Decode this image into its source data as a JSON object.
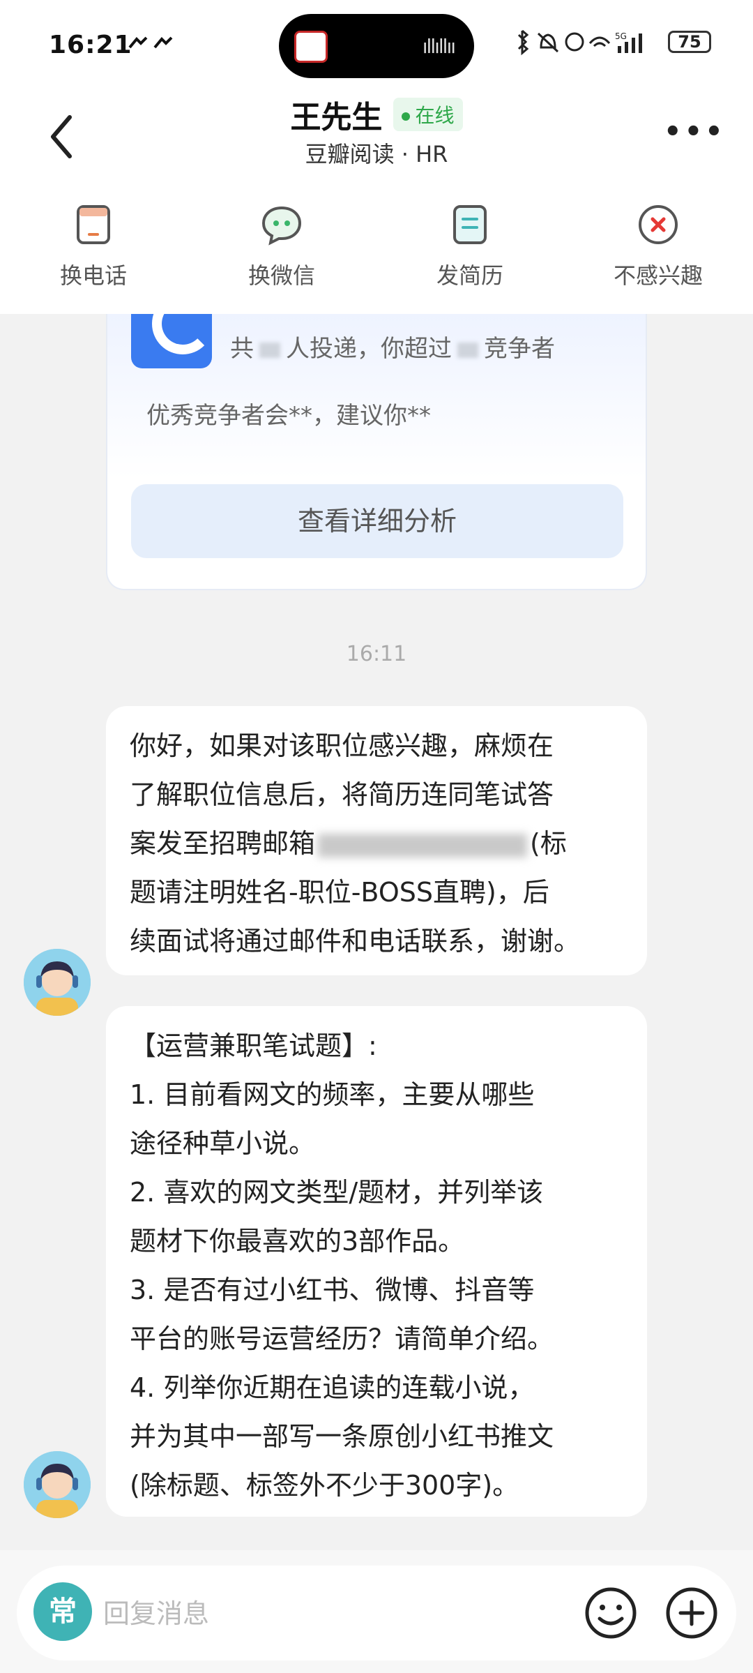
{
  "status_bar": {
    "time": "16:21",
    "battery": "75",
    "network": "5G"
  },
  "header": {
    "title": "王先生",
    "online_label": "在线",
    "subtitle": "豆瓣阅读 · HR"
  },
  "actions": [
    {
      "label": "换电话",
      "icon": "phone-icon"
    },
    {
      "label": "换微信",
      "icon": "wechat-icon"
    },
    {
      "label": "发简历",
      "icon": "resume-icon"
    },
    {
      "label": "不感兴趣",
      "icon": "not-interested-icon"
    }
  ],
  "card": {
    "stat_prefix": "共",
    "stat_mid": "人投递，你超过",
    "stat_suffix": "竞争者",
    "tip": "优秀竞争者会**，建议你**",
    "button": "查看详细分析"
  },
  "chat": {
    "timestamp": "16:11",
    "message1": {
      "lines": [
        "你好，如果对该职位感兴趣，麻烦在",
        "了解职位信息后，将简历连同笔试答",
        "案发至招聘邮箱",
        "(标",
        "题请注明姓名-职位-BOSS直聘)，后",
        "续面试将通过邮件和电话联系，谢谢。"
      ]
    },
    "message2": {
      "lines": [
        "【运营兼职笔试题】:",
        "1. 目前看网文的频率，主要从哪些",
        "途径种草小说。",
        "2. 喜欢的网文类型/题材，并列举该",
        "题材下你最喜欢的3部作品。",
        "3. 是否有过小红书、微博、抖音等",
        "平台的账号运营经历？请简单介绍。",
        "4. 列举你近期在追读的连载小说，",
        "并为其中一部写一条原创小红书推文",
        "(除标题、标签外不少于300字)。"
      ]
    }
  },
  "input": {
    "chang_label": "常",
    "placeholder": "回复消息"
  }
}
